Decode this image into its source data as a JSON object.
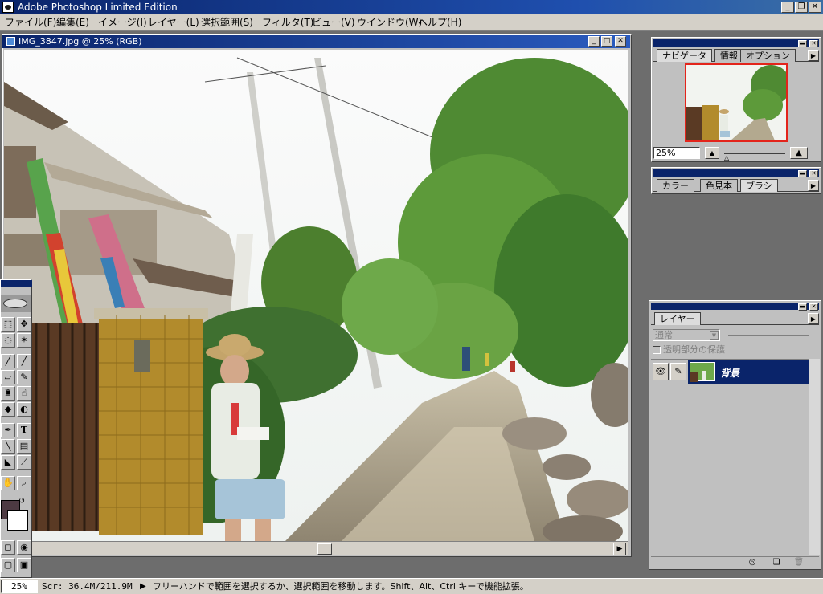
{
  "app": {
    "title": "Adobe Photoshop Limited Edition",
    "window_buttons": {
      "minimize": "_",
      "restore": "❐",
      "close": "✕"
    }
  },
  "menu": [
    "ファイル(F)",
    "編集(E)",
    "イメージ(I)",
    "レイヤー(L)",
    "選択範囲(S)",
    "フィルタ(T)",
    "ビュー(V)",
    "ウインドウ(W)",
    "ヘルプ(H)"
  ],
  "document": {
    "title": "IMG_3847.jpg @ 25% (RGB)",
    "buttons": {
      "minimize": "_",
      "maximize": "□",
      "close": "✕"
    },
    "scroll_arrow": "▶"
  },
  "navigator_palette": {
    "tabs": [
      "ナビゲータ",
      "情報",
      "オプション"
    ],
    "active_tab": 0,
    "zoom_value": "25%",
    "menu_arrow": "▶"
  },
  "color_palette": {
    "tabs": [
      "カラー",
      "色見本",
      "ブラシ"
    ],
    "active_tab": 2,
    "menu_arrow": "▶"
  },
  "layers_palette": {
    "tabs": [
      "レイヤー"
    ],
    "blend_mode": "通常",
    "preserve_transparency_label": "透明部分の保護",
    "preserve_transparency_checked": false,
    "layers": [
      {
        "name": "背景",
        "visible": true,
        "selected": true
      }
    ],
    "menu_arrow": "▶"
  },
  "toolbox": {
    "text_tool_glyph": "T"
  },
  "colors": {
    "foreground": "#4d3a42",
    "background": "#ffffff",
    "selection": "#0a246a"
  },
  "status": {
    "zoom": "25%",
    "scratch": "Scr: 36.4M/211.9M",
    "arrow": "▶",
    "hint": "フリーハンドで範囲を選択するか、選択範囲を移動します。Shift、Alt、Ctrl キーで機能拡張。"
  }
}
